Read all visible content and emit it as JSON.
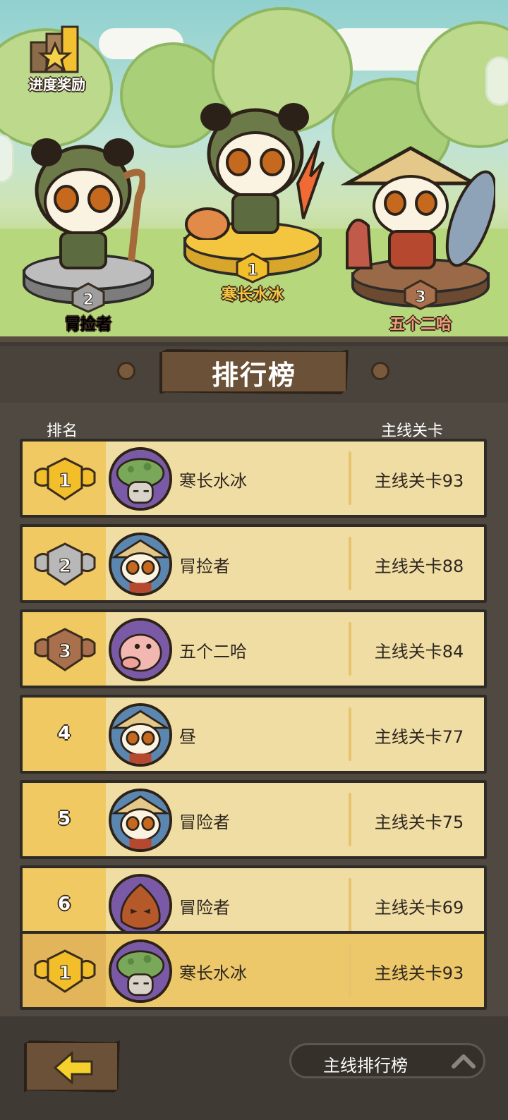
{
  "progress_reward": {
    "label": "进度奖励",
    "icon": "trophy-star-icon"
  },
  "podium": [
    {
      "rank": "2",
      "name": "冐捡者",
      "name_color": "#ffffff"
    },
    {
      "rank": "1",
      "name": "寒长水冰",
      "name_color": "#f5c542"
    },
    {
      "rank": "3",
      "name": "五个二哈",
      "name_color": "#f0a078"
    }
  ],
  "banner": {
    "title": "排行榜"
  },
  "columns": {
    "rank": "排名",
    "stage": "主线关卡"
  },
  "rows": [
    {
      "rank": "1",
      "medal": "gold",
      "avatar": "mushroom-avatar",
      "name": "寒长水冰",
      "stage": "主线关卡93"
    },
    {
      "rank": "2",
      "medal": "silver",
      "avatar": "panda-straw-hat-avatar",
      "name": "冐捡者",
      "stage": "主线关卡88"
    },
    {
      "rank": "3",
      "medal": "bronze",
      "avatar": "pig-avatar",
      "name": "五个二哈",
      "stage": "主线关卡84"
    },
    {
      "rank": "4",
      "medal": "",
      "avatar": "panda-straw-hat-avatar",
      "name": "昼",
      "stage": "主线关卡77"
    },
    {
      "rank": "5",
      "medal": "",
      "avatar": "panda-straw-hat-avatar",
      "name": "冒险者",
      "stage": "主线关卡75"
    },
    {
      "rank": "6",
      "medal": "",
      "avatar": "chestnut-avatar",
      "name": "冒险者",
      "stage": "主线关卡69"
    }
  ],
  "my_rank": {
    "rank": "1",
    "medal": "gold",
    "avatar": "mushroom-avatar",
    "name": "寒长水冰",
    "stage": "主线关卡93"
  },
  "footer": {
    "back_icon": "arrow-left-icon",
    "switch_label": "主线排行榜",
    "switch_icon": "chevron-up-icon"
  },
  "colors": {
    "gold": "#f5c542",
    "silver": "#c8c8c8",
    "bronze": "#a8704c",
    "accent_yellow": "#f0c962"
  }
}
